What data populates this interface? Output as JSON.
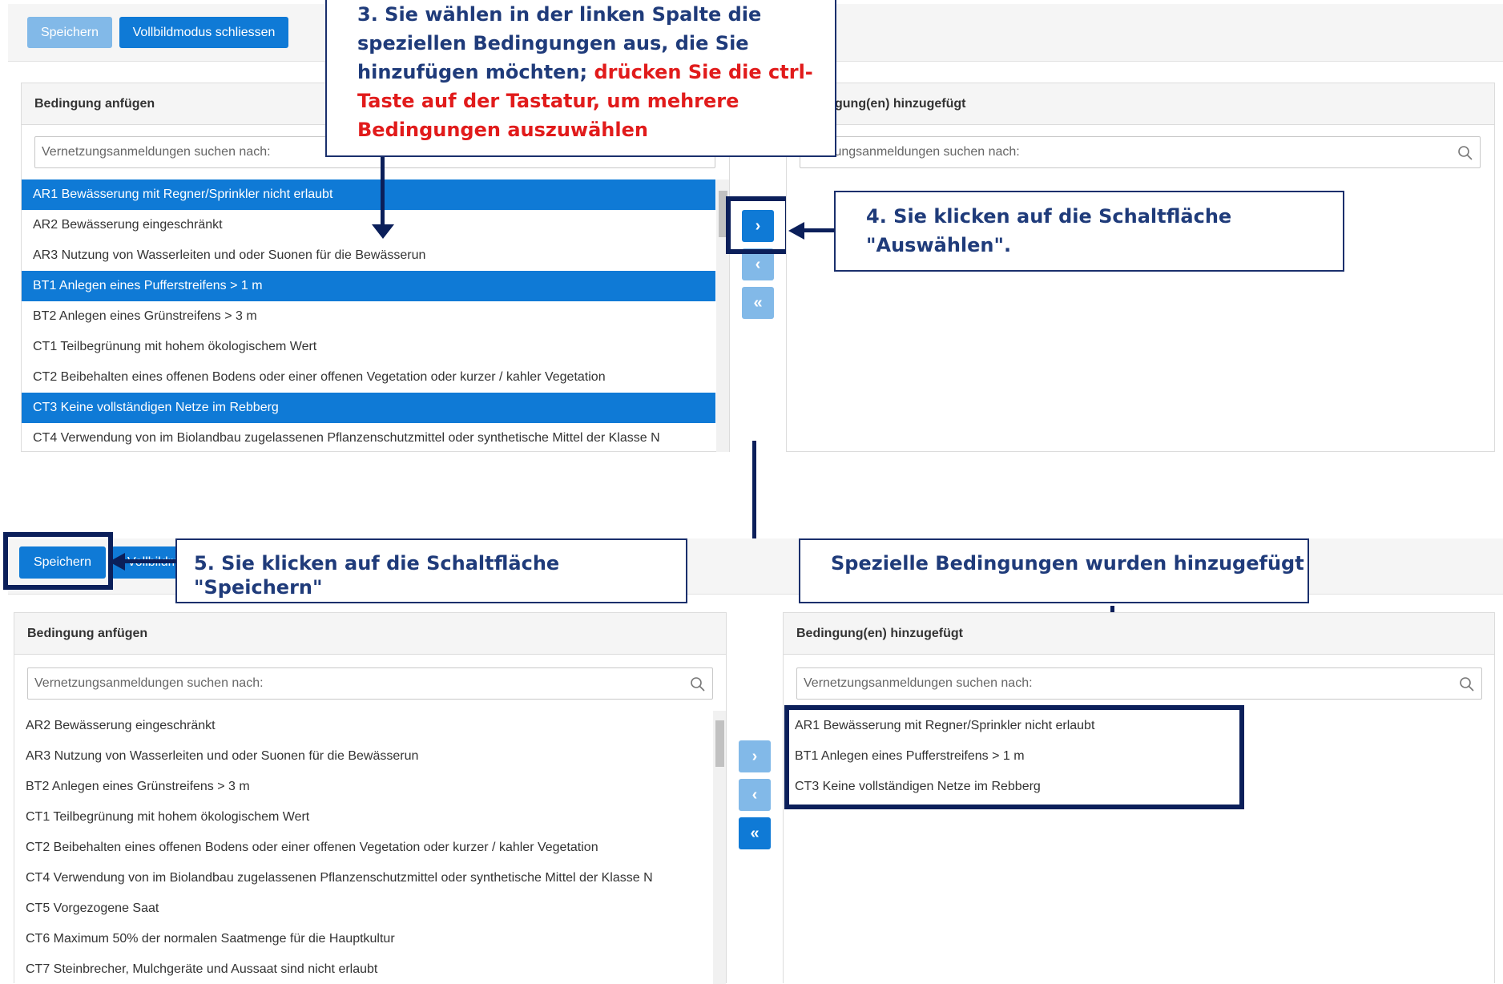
{
  "top": {
    "toolbar": {
      "save_label": "Speichern",
      "fullscreen_label": "Vollbildmodus schliessen"
    },
    "left_panel": {
      "title": "Bedingung anfügen",
      "search_placeholder": "Vernetzungsanmeldungen suchen nach:",
      "items": [
        {
          "label": "AR1 Bewässerung mit Regner/Sprinkler nicht erlaubt",
          "selected": true
        },
        {
          "label": "AR2 Bewässerung eingeschränkt",
          "selected": false
        },
        {
          "label": "AR3 Nutzung von Wasserleiten und oder Suonen für die Bewässerun",
          "selected": false
        },
        {
          "label": "BT1 Anlegen eines Pufferstreifens > 1 m",
          "selected": true
        },
        {
          "label": "BT2 Anlegen eines Grünstreifens > 3 m",
          "selected": false
        },
        {
          "label": "CT1 Teilbegrünung mit hohem ökologischem Wert",
          "selected": false
        },
        {
          "label": "CT2 Beibehalten eines offenen Bodens oder einer offenen Vegetation oder kurzer / kahler Vegetation",
          "selected": false
        },
        {
          "label": "CT3 Keine vollständigen Netze im Rebberg",
          "selected": true
        },
        {
          "label": "CT4 Verwendung von im Biolandbau zugelassenen Pflanzenschutzmittel oder synthetische Mittel der Klasse N",
          "selected": false
        }
      ]
    },
    "right_panel": {
      "title_visible": "gung(en) hinzugefügt",
      "search_placeholder_visible": "tzungsanmeldungen suchen nach:"
    },
    "move_buttons": {
      "select": "›",
      "deselect": "‹",
      "deselect_all": "«"
    }
  },
  "bottom": {
    "toolbar": {
      "save_label": "Speichern",
      "fullscreen_label_visible": "Vollbildm"
    },
    "left_panel": {
      "title": "Bedingung anfügen",
      "search_placeholder": "Vernetzungsanmeldungen suchen nach:",
      "items": [
        "AR2 Bewässerung eingeschränkt",
        "AR3 Nutzung von Wasserleiten und oder Suonen für die Bewässerun",
        "BT2 Anlegen eines Grünstreifens > 3 m",
        "CT1 Teilbegrünung mit hohem ökologischem Wert",
        "CT2 Beibehalten eines offenen Bodens oder einer offenen Vegetation oder kurzer / kahler Vegetation",
        "CT4 Verwendung von im Biolandbau zugelassenen Pflanzenschutzmittel oder synthetische Mittel der Klasse N",
        "CT5 Vorgezogene Saat",
        "CT6 Maximum 50% der normalen Saatmenge für die Hauptkultur",
        "CT7 Steinbrecher, Mulchgeräte und Aussaat sind nicht erlaubt"
      ]
    },
    "right_panel": {
      "title": "Bedingung(en) hinzugefügt",
      "search_placeholder": "Vernetzungsanmeldungen suchen nach:",
      "items": [
        "AR1 Bewässerung mit Regner/Sprinkler nicht erlaubt",
        "BT1 Anlegen eines Pufferstreifens > 1 m",
        "CT3 Keine vollständigen Netze im Rebberg"
      ]
    },
    "move_buttons": {
      "select": "›",
      "deselect": "‹",
      "deselect_all": "«"
    }
  },
  "callouts": {
    "step3_blue": "3.  Sie wählen in der linken Spalte die speziellen Bedingungen aus, die Sie hinzufügen möchten;",
    "step3_red": "drücken Sie die ctrl-Taste auf der Tastatur, um mehrere Bedingungen auszuwählen",
    "step4": "4.  Sie klicken auf die Schaltfläche \"Auswählen\".",
    "step5": "5. Sie klicken auf die Schaltfläche \"Speichern\"",
    "result": "Spezielle Bedingungen wurden hinzugefügt"
  },
  "colors": {
    "primary": "#0f7ad6",
    "primary_light": "#82b9e8",
    "annotation": "#0b1f5a",
    "annotation_text": "#1f3b7a",
    "emphasis": "#e11b1b"
  }
}
